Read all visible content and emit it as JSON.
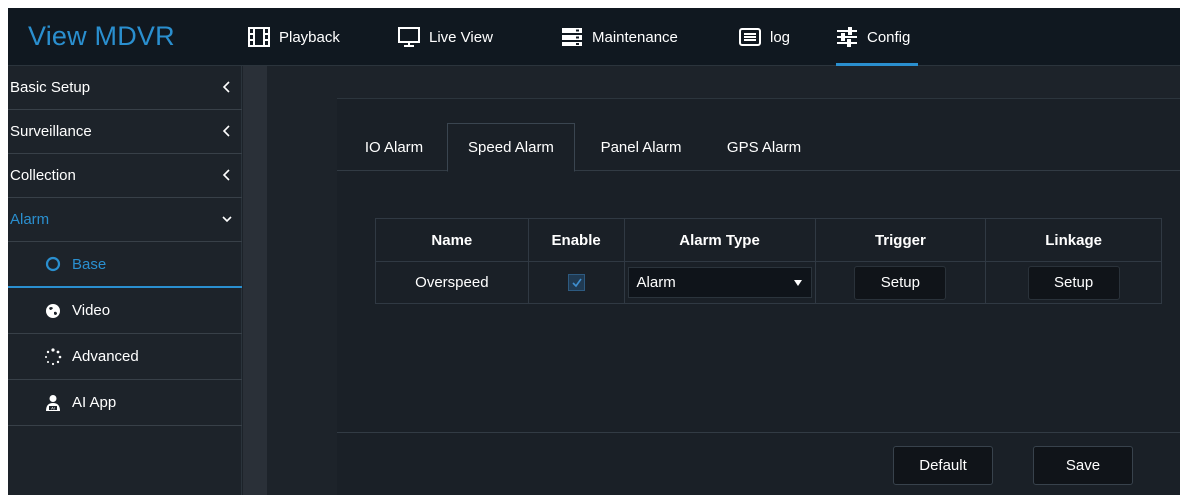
{
  "app": {
    "title": "View MDVR"
  },
  "nav": [
    {
      "label": "Playback",
      "icon": "film-icon"
    },
    {
      "label": "Live View",
      "icon": "monitor-icon"
    },
    {
      "label": "Maintenance",
      "icon": "server-icon"
    },
    {
      "label": "log",
      "icon": "list-icon"
    },
    {
      "label": "Config",
      "icon": "sliders-icon",
      "active": true
    }
  ],
  "sidebar": {
    "groups": [
      {
        "label": "Basic Setup",
        "state": "collapsed"
      },
      {
        "label": "Surveillance",
        "state": "collapsed"
      },
      {
        "label": "Collection",
        "state": "collapsed"
      },
      {
        "label": "Alarm",
        "state": "expanded"
      }
    ],
    "alarm_items": [
      {
        "label": "Base",
        "icon": "circle-icon",
        "active": true
      },
      {
        "label": "Video",
        "icon": "globe-icon"
      },
      {
        "label": "Advanced",
        "icon": "spinner-icon"
      },
      {
        "label": "AI App",
        "icon": "ai-user-icon"
      }
    ]
  },
  "tabs": [
    {
      "label": "IO Alarm"
    },
    {
      "label": "Speed Alarm",
      "active": true
    },
    {
      "label": "Panel Alarm"
    },
    {
      "label": "GPS Alarm"
    }
  ],
  "table": {
    "headers": [
      "Name",
      "Enable",
      "Alarm Type",
      "Trigger",
      "Linkage"
    ],
    "rows": [
      {
        "name": "Overspeed",
        "enabled": true,
        "alarm_type": "Alarm",
        "trigger": "Setup",
        "linkage": "Setup"
      }
    ]
  },
  "footer": {
    "default_label": "Default",
    "save_label": "Save"
  },
  "colors": {
    "accent": "#2a8fcf",
    "background": "#1d232a",
    "header": "#101820"
  }
}
